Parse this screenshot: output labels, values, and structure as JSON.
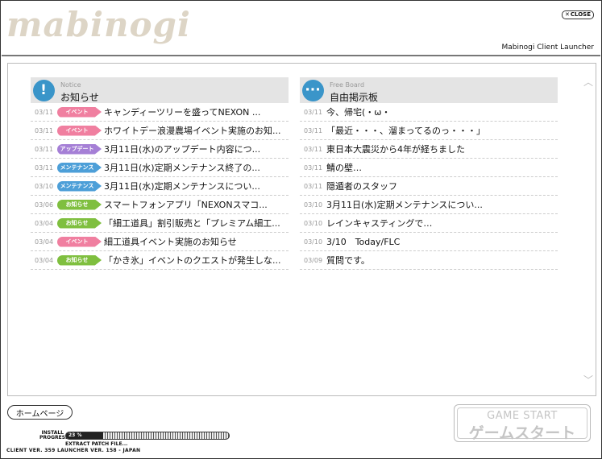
{
  "header": {
    "logo": "mabinogi",
    "close_label": "CLOSE",
    "title": "Mabinogi Client Launcher"
  },
  "notice": {
    "eng": "Notice",
    "jp": "お知らせ",
    "icon": "exclamation-icon",
    "items": [
      {
        "date": "03/11",
        "badge": "イベント",
        "badge_color": "#f07fa0",
        "title": "キャンディーツリーを盛ってNEXON ..."
      },
      {
        "date": "03/11",
        "badge": "イベント",
        "badge_color": "#f07fa0",
        "title": "ホワイトデー浪漫農場イベント実施のお知..."
      },
      {
        "date": "03/11",
        "badge": "アップデート",
        "badge_color": "#a57fd6",
        "title": "3月11日(水)のアップデート内容につ..."
      },
      {
        "date": "03/11",
        "badge": "メンテナンス",
        "badge_color": "#4d9fd8",
        "title": "3月11日(水)定期メンテナンス終了の..."
      },
      {
        "date": "03/10",
        "badge": "メンテナンス",
        "badge_color": "#4d9fd8",
        "title": "3月11日(水)定期メンテナンスについ..."
      },
      {
        "date": "03/06",
        "badge": "お知らせ",
        "badge_color": "#7fbf3f",
        "title": "スマートフォンアプリ「NEXONスマコ..."
      },
      {
        "date": "03/04",
        "badge": "お知らせ",
        "badge_color": "#7fbf3f",
        "title": "「細工道具」割引販売と「プレミアム細工..."
      },
      {
        "date": "03/04",
        "badge": "イベント",
        "badge_color": "#f07fa0",
        "title": "細工道具イベント実施のお知らせ"
      },
      {
        "date": "03/04",
        "badge": "お知らせ",
        "badge_color": "#7fbf3f",
        "title": "「かき氷」イベントのクエストが発生しな..."
      }
    ]
  },
  "board": {
    "eng": "Free Board",
    "jp": "自由掲示板",
    "icon": "speech-bubble-icon",
    "items": [
      {
        "date": "03/11",
        "title": "今、帰宅(・ω・"
      },
      {
        "date": "03/11",
        "title": "「最近・・・、溜まってるのっ・・・」"
      },
      {
        "date": "03/11",
        "title": "東日本大震災から4年が経ちました"
      },
      {
        "date": "03/11",
        "title": "鯖の壁…"
      },
      {
        "date": "03/11",
        "title": "隠遁者のスタッフ"
      },
      {
        "date": "03/10",
        "title": "3月11日(水)定期メンテナンスについ..."
      },
      {
        "date": "03/10",
        "title": "レインキャスティングで…"
      },
      {
        "date": "03/10",
        "title": "3/10　Today/FLC"
      },
      {
        "date": "03/09",
        "title": "質問です。"
      }
    ]
  },
  "footer": {
    "home_label": "ホームページ",
    "install_label_1": "INSTALL",
    "install_label_2": "PROGRESS",
    "progress_percent": 23,
    "progress_text": "23 %",
    "extract_text": "EXTRACT PATCH FILE...",
    "version_text": "CLIENT VER. 359   LAUNCHER VER. 158 - JAPAN",
    "start_eng": "GAME START",
    "start_jp": "ゲームスタート"
  }
}
